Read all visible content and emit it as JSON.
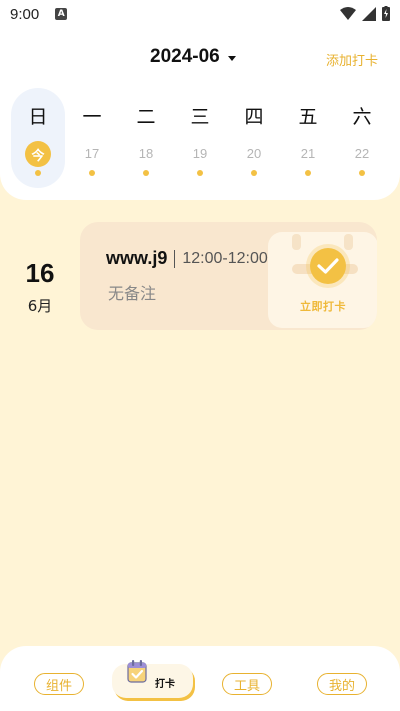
{
  "status_bar": {
    "time": "9:00",
    "notification_icon": "A"
  },
  "header": {
    "month": "2024-06",
    "add_checkin": "添加打卡"
  },
  "week": [
    {
      "weekday": "日",
      "date": "今",
      "is_today": true
    },
    {
      "weekday": "一",
      "date": "17",
      "is_today": false
    },
    {
      "weekday": "二",
      "date": "18",
      "is_today": false
    },
    {
      "weekday": "三",
      "date": "19",
      "is_today": false
    },
    {
      "weekday": "四",
      "date": "20",
      "is_today": false
    },
    {
      "weekday": "五",
      "date": "21",
      "is_today": false
    },
    {
      "weekday": "六",
      "date": "22",
      "is_today": false
    }
  ],
  "selected_date": {
    "day": "16",
    "month": "6月"
  },
  "task": {
    "title": "www.j9",
    "time": "12:00-12:00",
    "note": "无备注",
    "checkin_label": "立即打卡"
  },
  "bottom_nav": {
    "components": "组件",
    "checkin": "打卡",
    "tools": "工具",
    "mine": "我的"
  },
  "colors": {
    "accent": "#f3c144",
    "background": "#fff4d6",
    "card": "#f9e7cf"
  }
}
